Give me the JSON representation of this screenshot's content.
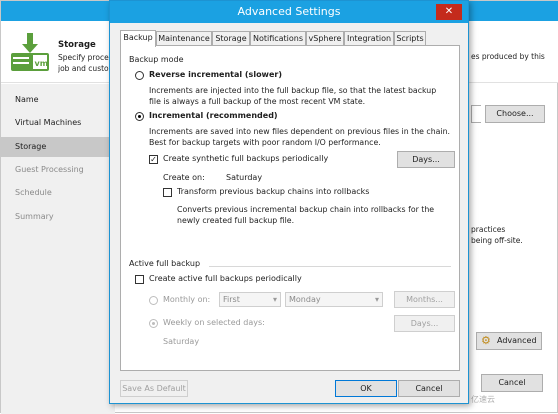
{
  "background": {
    "step_title": "Storage",
    "step_desc": "Specify processing location and retention settings for this job and custom...",
    "step_desc_right": "es produced by this",
    "nav": [
      "Name",
      "Virtual Machines",
      "Storage",
      "Guest Processing",
      "Schedule",
      "Summary"
    ],
    "choose_label": "Choose...",
    "practices_line1": "practices",
    "practices_line2": "being off-site.",
    "advanced_label": "Advanced",
    "cancel_label": "Cancel",
    "watermark": "亿速云"
  },
  "dialog": {
    "title": "Advanced Settings",
    "close_glyph": "✕",
    "tabs": [
      "Backup",
      "Maintenance",
      "Storage",
      "Notifications",
      "vSphere",
      "Integration",
      "Scripts"
    ],
    "backup_mode_label": "Backup mode",
    "reverse_label": "Reverse incremental (slower)",
    "reverse_desc": "Increments are injected into the full backup file, so that the latest backup file is always a full backup of the most recent VM state.",
    "incremental_label": "Incremental (recommended)",
    "incremental_desc": "Increments are saved into new files dependent on previous files in the chain. Best for backup targets with poor random I/O performance.",
    "synthetic_label": "Create synthetic full backups periodically",
    "days_label": "Days...",
    "create_on_label": "Create on:",
    "create_on_value": "Saturday",
    "transform_label": "Transform previous backup chains into rollbacks",
    "transform_desc": "Converts previous incremental backup chain into rollbacks for the newly created full backup file.",
    "active_full_label": "Active full backup",
    "active_full_cb_label": "Create active full backups periodically",
    "monthly_label": "Monthly on:",
    "monthly_first": "First",
    "monthly_day": "Monday",
    "months_label": "Months...",
    "weekly_label": "Weekly on selected days:",
    "weekly_days_label": "Days...",
    "weekly_value": "Saturday",
    "save_default_label": "Save As Default",
    "ok_label": "OK",
    "cancel_label": "Cancel"
  }
}
